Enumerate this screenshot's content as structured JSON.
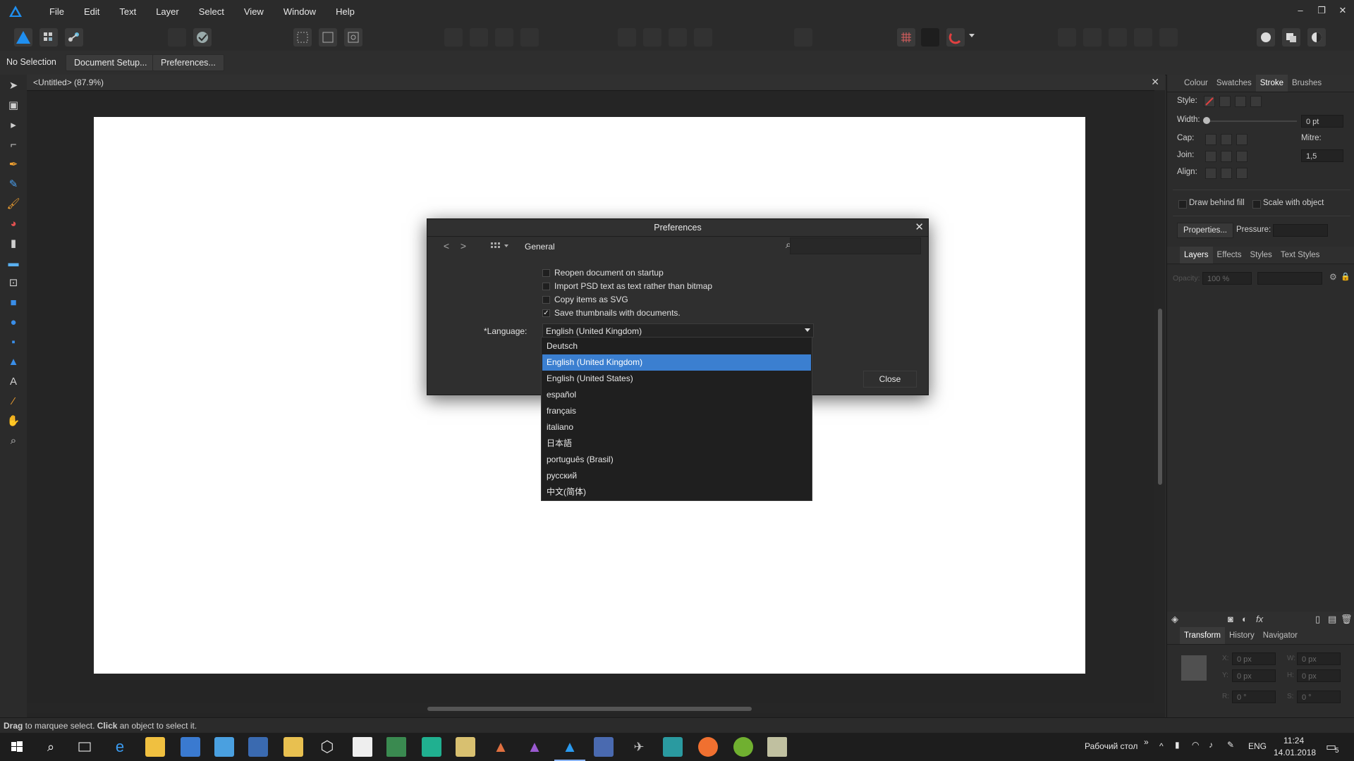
{
  "menubar": {
    "items": [
      "File",
      "Edit",
      "Text",
      "Layer",
      "Select",
      "View",
      "Window",
      "Help"
    ],
    "window_controls": {
      "minimize": "–",
      "restore": "❐",
      "close": "✕"
    }
  },
  "context": {
    "selection_status": "No Selection",
    "document_setup_label": "Document Setup...",
    "preferences_label": "Preferences..."
  },
  "document": {
    "tab_title": "<Untitled> (87.9%)",
    "close_glyph": "✕"
  },
  "right_panel": {
    "top_tabs": [
      "Colour",
      "Swatches",
      "Stroke",
      "Brushes"
    ],
    "active_top_tab": "Stroke",
    "stroke": {
      "style_label": "Style:",
      "width_label": "Width:",
      "width_value": "0 pt",
      "cap_label": "Cap:",
      "mitre_label": "Mitre:",
      "join_label": "Join:",
      "mitre_value": "1,5",
      "align_label": "Align:",
      "draw_behind_fill": "Draw behind fill",
      "scale_with_object": "Scale with object",
      "properties_label": "Properties...",
      "pressure_label": "Pressure:"
    },
    "layers_tabs": [
      "Layers",
      "Effects",
      "Styles",
      "Text Styles"
    ],
    "active_layers_tab": "Layers",
    "layers": {
      "opacity_label": "Opacity:",
      "opacity_value": "100 %"
    },
    "bottom_tabs": [
      "Transform",
      "History",
      "Navigator"
    ],
    "active_bottom_tab": "Transform",
    "transform": {
      "x_label": "X:",
      "x_value": "0 px",
      "y_label": "Y:",
      "y_value": "0 px",
      "w_label": "W:",
      "w_value": "0 px",
      "h_label": "H:",
      "h_value": "0 px",
      "r_label": "R:",
      "r_value": "0 °",
      "s_label": "S:",
      "s_value": "0 °"
    }
  },
  "statusbar": {
    "drag_bold": "Drag",
    "drag_text": " to marquee select. ",
    "click_bold": "Click",
    "click_text": " an object to select it."
  },
  "dialog": {
    "title": "Preferences",
    "section": "General",
    "options": [
      {
        "label": "Reopen document on startup",
        "checked": false
      },
      {
        "label": "Import PSD text as text rather than bitmap",
        "checked": false
      },
      {
        "label": "Copy items as SVG",
        "checked": false
      },
      {
        "label": "Save thumbnails with documents.",
        "checked": true
      }
    ],
    "language_label": "*Language:",
    "language_value": "English (United Kingdom)",
    "close_label": "Close",
    "close_glyph": "✕",
    "nav_back": "<",
    "nav_forward": ">"
  },
  "language_dropdown": {
    "options": [
      "Deutsch",
      "English (United Kingdom)",
      "English (United States)",
      "español",
      "français",
      "italiano",
      "日本語",
      "português (Brasil)",
      "русский",
      "中文(简体)"
    ],
    "selected": "English (United Kingdom)"
  },
  "taskbar": {
    "desktop_label": "Рабочий стол",
    "chevron": "»",
    "lang": "ENG",
    "time": "11:24",
    "date": "14.01.2018",
    "notification_count": "5"
  },
  "colors": {
    "accent": "#3b7fd0",
    "canvas": "#ffffff",
    "ui_dark": "#2b2b2b"
  }
}
